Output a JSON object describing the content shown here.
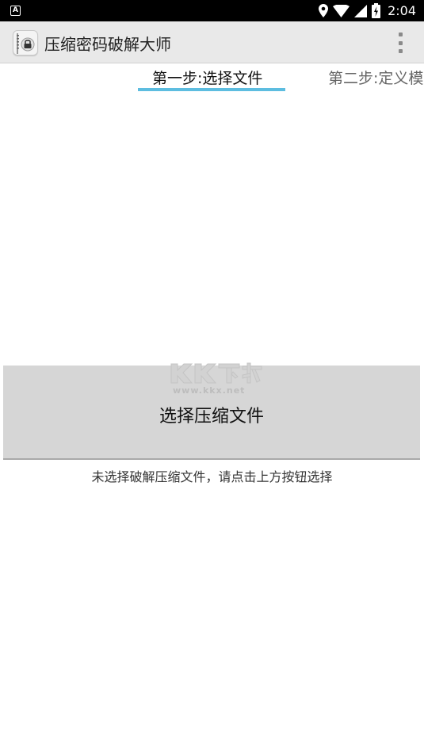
{
  "status_bar": {
    "app_icon_letter": "A",
    "time": "2:04",
    "icons": [
      "location-icon",
      "wifi-icon",
      "signal-icon",
      "battery-icon"
    ]
  },
  "app_bar": {
    "title": "压缩密码破解大师",
    "logo_icon": "zip-lock-icon",
    "menu_icon": "overflow-menu-icon"
  },
  "tabs": [
    {
      "label": "第一步:选择文件",
      "selected": true
    },
    {
      "label": "第二步:定义模",
      "selected": false
    }
  ],
  "accent_color": "#5dbde0",
  "main": {
    "select_button_label": "选择压缩文件",
    "watermark_logo": "KK下载",
    "watermark_url": "www.kkx.net",
    "hint": "未选择破解压缩文件，请点击上方按钮选择"
  }
}
